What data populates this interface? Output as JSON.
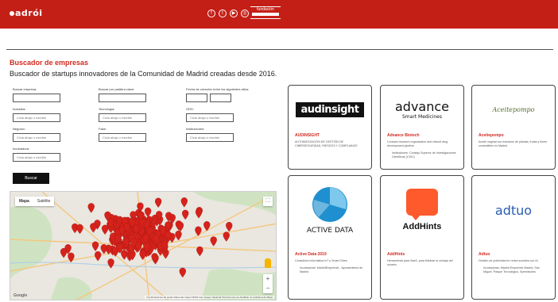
{
  "header": {
    "logo_text": "adrói",
    "social_icons": [
      "facebook-icon",
      "twitter-icon",
      "youtube-icon",
      "instagram-icon"
    ],
    "partner_text": "fundación"
  },
  "page": {
    "title": "Buscador de empresas",
    "subtitle": "Buscador de startups innovadores de la Comunidad de Madrid creadas desde 2016."
  },
  "form": {
    "labels": {
      "company": "Buscar empresa:",
      "keyword": "Buscar por palabra clave:",
      "date": "Fecha de creación entre los siguientes años:",
      "industry": "Industria:",
      "technology": "Tecnología:",
      "ods": "ODS:",
      "business": "Negocio:",
      "phase": "Fase:",
      "institutions": "Instituciones:",
      "incubators": "Incubadora:"
    },
    "placeholder": "Cicla abajo o escribe",
    "submit_label": "Buscar"
  },
  "map": {
    "tab_map": "Mapa",
    "tab_satellite": "Satélite",
    "zoom_in": "+",
    "zoom_out": "−",
    "google_label": "Google",
    "attribution": "Combinaciones de teclas   Datos del mapa ©2022 Inst. Geogr. Nacional   Términos de uso   Notificar un problema de Maps",
    "marker_color": "#d6221b"
  },
  "cards": [
    {
      "logo_text": "audinsight",
      "name": "AUDINSIGHT",
      "description": "AUTOMATIZACIÓN DE GESTIÓN DE CIBERSEGURIDAD, RIESGOS Y COMPLIANCE",
      "extra": ""
    },
    {
      "logo_text": "advance",
      "logo_sub": "Smart Medicines",
      "name": "Advance Biotech",
      "description": "Contract research organization and clinical drug development pipeline",
      "extra": "Instituciones: Consejo Superior de Investigaciones Científicas (CSIC)"
    },
    {
      "logo_text": "Aceitepompo",
      "name": "Aceitepompo",
      "description": "Aceite vegetal con extractos de plántas, frutas y flores comestibles en Madrid",
      "extra": ""
    },
    {
      "logo_text": "ACTIVE DATA",
      "name": "Active Data 2019",
      "description": "Consultora Informática IoT y Smart Cities",
      "extra": "Incubadoras: MadridEmprende - Ayuntamiento de Madrid"
    },
    {
      "logo_text": "AddHints",
      "name": "AddHints",
      "description": "Herramienta para SaaS, para fidelizar la ventaja del usuario",
      "extra": ""
    },
    {
      "logo_text": "adtuo",
      "name": "Adtuo",
      "description": "Gestión de publicidad en redes sociales con IA",
      "extra": "Incubadoras: Madrid Emprende Madrid, San Miguel, Parque Tecnológico, Speedworks"
    }
  ]
}
